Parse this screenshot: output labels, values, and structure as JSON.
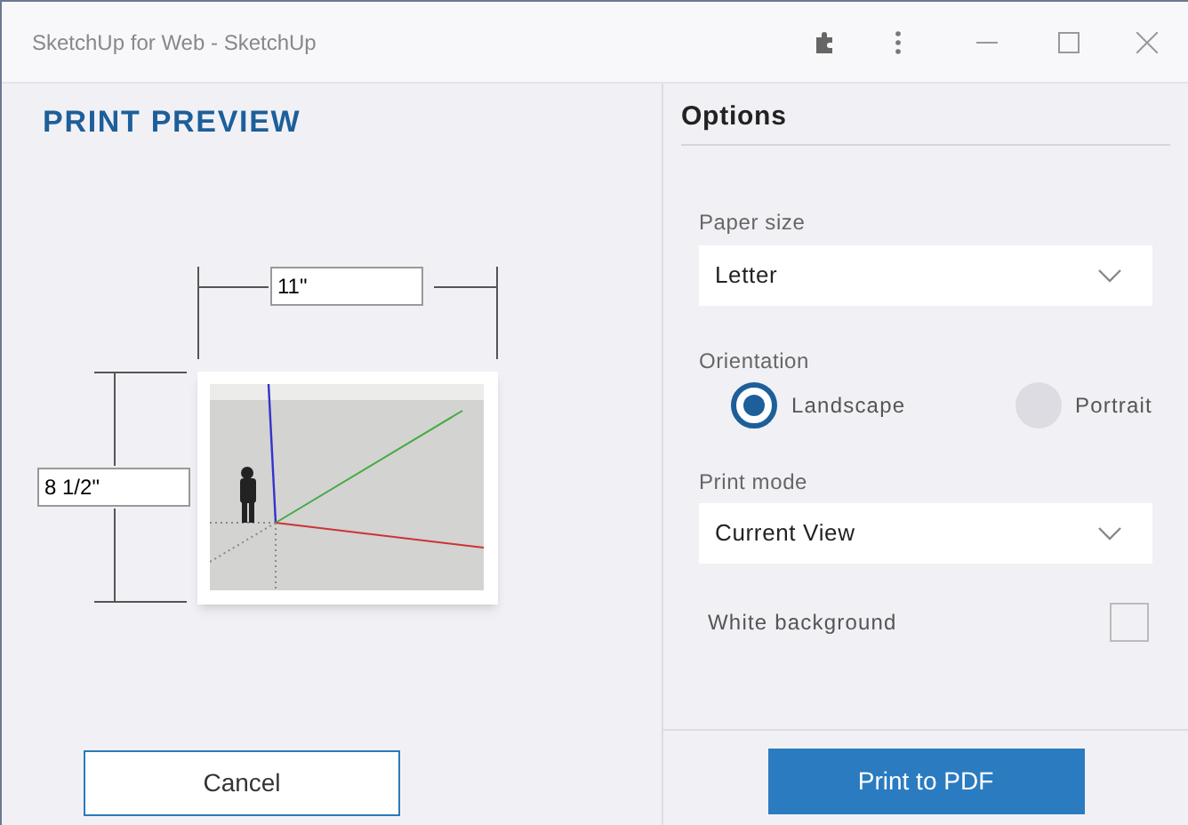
{
  "window": {
    "title": "SketchUp for Web - SketchUp"
  },
  "preview": {
    "title": "PRINT PREVIEW",
    "width": "11\"",
    "height": "8 1/2\""
  },
  "options": {
    "title": "Options",
    "paper_size": {
      "label": "Paper size",
      "value": "Letter"
    },
    "orientation": {
      "label": "Orientation",
      "choices": [
        {
          "label": "Landscape",
          "selected": true
        },
        {
          "label": "Portrait",
          "selected": false
        }
      ]
    },
    "print_mode": {
      "label": "Print mode",
      "value": "Current View"
    },
    "white_background": {
      "label": "White background",
      "checked": false
    }
  },
  "buttons": {
    "cancel": "Cancel",
    "print": "Print to PDF"
  }
}
